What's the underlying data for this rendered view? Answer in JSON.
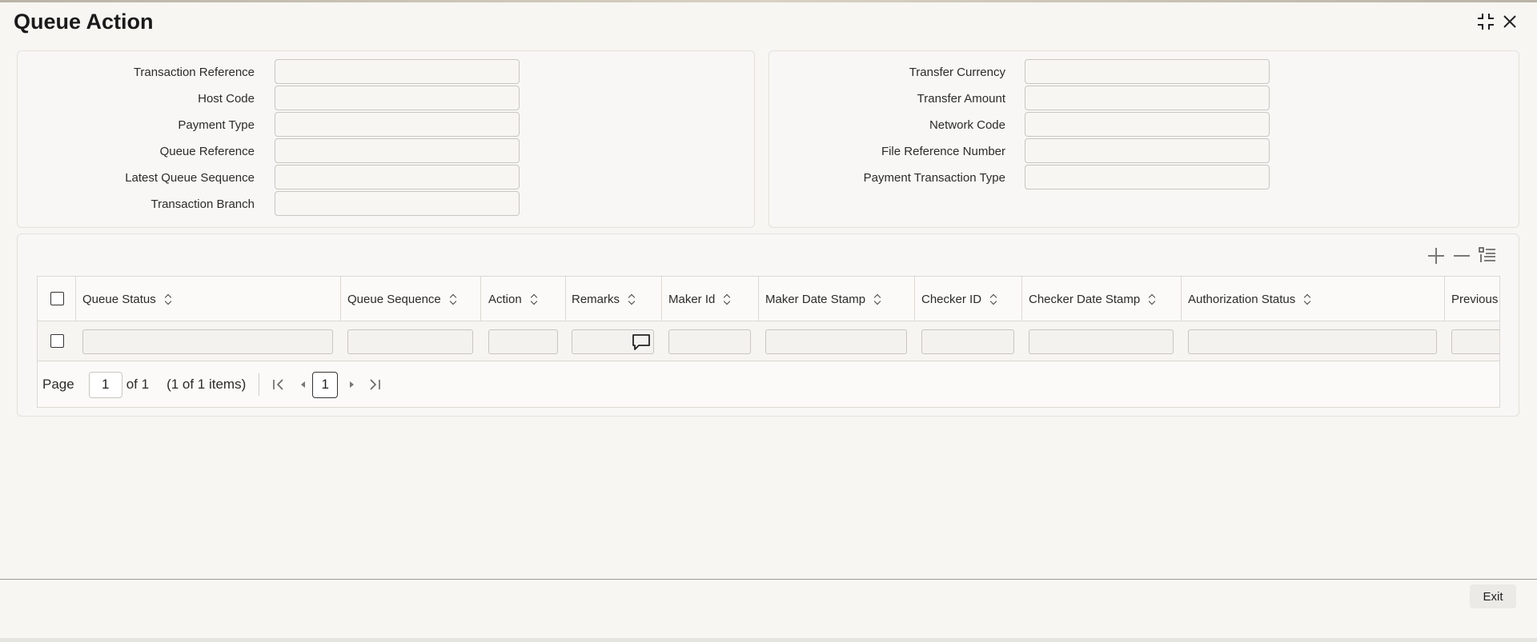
{
  "window": {
    "title": "Queue Action"
  },
  "left_panel": {
    "fields": [
      {
        "label": "Transaction Reference",
        "value": ""
      },
      {
        "label": "Host Code",
        "value": ""
      },
      {
        "label": "Payment Type",
        "value": ""
      },
      {
        "label": "Queue Reference",
        "value": ""
      },
      {
        "label": "Latest Queue Sequence",
        "value": ""
      },
      {
        "label": "Transaction Branch",
        "value": ""
      }
    ]
  },
  "right_panel": {
    "fields": [
      {
        "label": "Transfer Currency",
        "value": ""
      },
      {
        "label": "Transfer Amount",
        "value": ""
      },
      {
        "label": "Network Code",
        "value": ""
      },
      {
        "label": "File Reference Number",
        "value": ""
      },
      {
        "label": "Payment Transaction Type",
        "value": ""
      }
    ]
  },
  "grid": {
    "columns": [
      "Queue Status",
      "Queue Sequence",
      "Action",
      "Remarks",
      "Maker Id",
      "Maker Date Stamp",
      "Checker ID",
      "Checker Date Stamp",
      "Authorization Status",
      "Previous"
    ],
    "rows": [
      [
        "",
        "",
        "",
        "",
        "",
        "",
        "",
        "",
        "",
        ""
      ]
    ],
    "toolbar_icons": [
      "add-icon",
      "remove-icon",
      "column-settings-icon"
    ]
  },
  "pager": {
    "page_label": "Page",
    "page_value": "1",
    "of_label": "of 1",
    "items_label": "(1 of 1 items)",
    "current_page": "1"
  },
  "footer": {
    "exit_label": "Exit"
  }
}
